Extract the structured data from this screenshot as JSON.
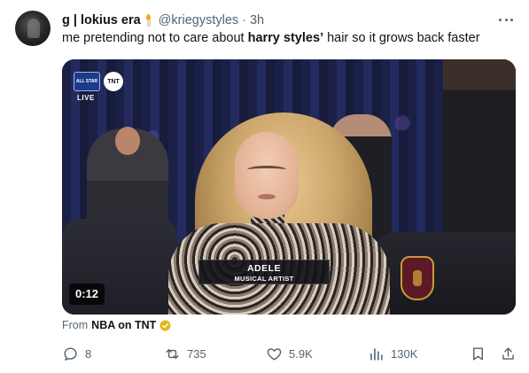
{
  "author": {
    "display_name": "g | lokius era",
    "handle": "@kriegystyles",
    "time": "3h",
    "avatar_icon": "avatar-image"
  },
  "tweet": {
    "text_before": "me pretending not to care about ",
    "text_bold": "harry styles’",
    "text_after": " hair so it grows back faster"
  },
  "media": {
    "broadcast_logo_text": "ALL STAR",
    "network_logo_text": "TNT",
    "live_label": "LIVE",
    "lower_third_name": "ADELE",
    "lower_third_role": "MUSICAL ARTIST",
    "duration": "0:12"
  },
  "source": {
    "prefix": "From",
    "name": "NBA on TNT",
    "badge_color": "#e2b719"
  },
  "actions": {
    "replies": "8",
    "reposts": "735",
    "likes": "5.9K",
    "views": "130K"
  },
  "colors": {
    "primary_text": "#0f1419",
    "secondary_text": "#536471"
  }
}
